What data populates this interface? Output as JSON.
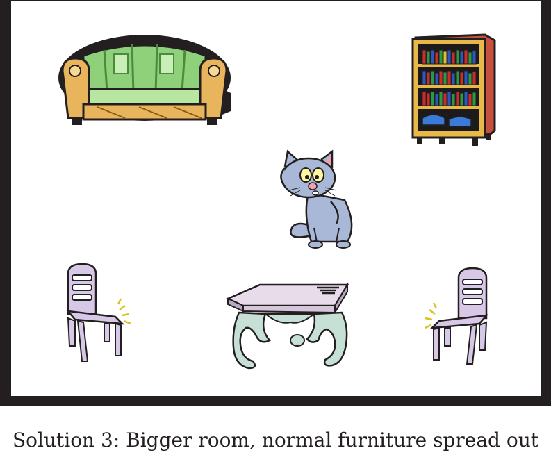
{
  "caption": "Solution 3: Bigger room, normal furniture spread out",
  "items": [
    {
      "id": "sofa",
      "icon": "sofa-icon"
    },
    {
      "id": "bookshelf",
      "icon": "bookshelf-icon"
    },
    {
      "id": "cat",
      "icon": "cat-icon"
    },
    {
      "id": "chair-left",
      "icon": "chair-icon"
    },
    {
      "id": "table",
      "icon": "table-icon"
    },
    {
      "id": "chair-right",
      "icon": "chair-icon"
    }
  ],
  "colors": {
    "frame": "#231f20",
    "sofa_green": "#8fd07a",
    "sofa_wood": "#e8b55c",
    "shelf_wood": "#e8b848",
    "shelf_side": "#c8503c",
    "cat_blue": "#a9b8d6",
    "chair_lilac": "#d7c8e8",
    "table_top": "#e8dcea",
    "table_legs": "#c6e0d6"
  }
}
